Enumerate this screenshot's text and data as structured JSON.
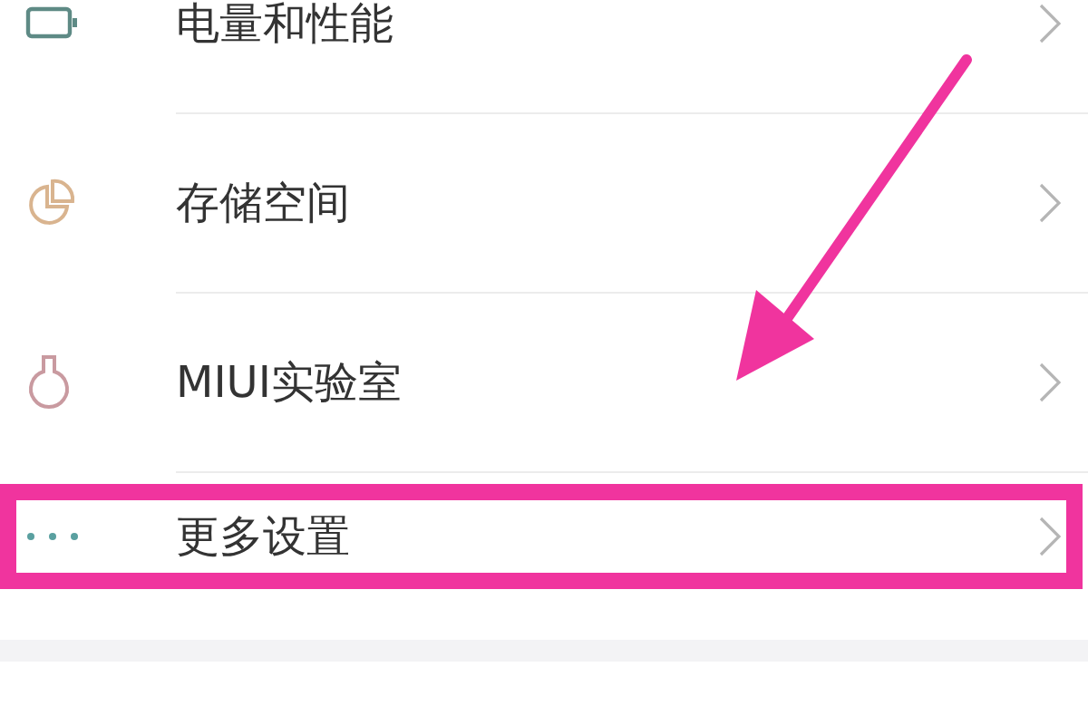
{
  "settings_items": [
    {
      "label": "电量和性能",
      "highlighted": false
    },
    {
      "label": "存储空间",
      "highlighted": false
    },
    {
      "label": "MIUI实验室",
      "highlighted": false
    },
    {
      "label": "更多设置",
      "highlighted": true
    }
  ]
}
